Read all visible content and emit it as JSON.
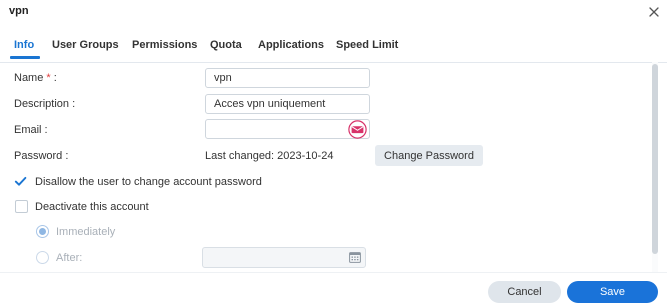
{
  "window": {
    "title": "vpn"
  },
  "tabs": [
    {
      "label": "Info",
      "active": true
    },
    {
      "label": "User Groups"
    },
    {
      "label": "Permissions"
    },
    {
      "label": "Quota"
    },
    {
      "label": "Applications"
    },
    {
      "label": "Speed Limit"
    }
  ],
  "form": {
    "name": {
      "label": "Name",
      "required_mark": "*",
      "colon": ":",
      "value": "vpn"
    },
    "description": {
      "label": "Description :",
      "value": "Acces vpn uniquement"
    },
    "email": {
      "label": "Email :",
      "value": "",
      "icon": "mail-icon"
    },
    "password": {
      "label": "Password :",
      "last_changed": "Last changed: 2023-10-24",
      "button": "Change Password"
    },
    "disallow_change": {
      "label": "Disallow the user to change account password",
      "checked": true
    },
    "deactivate": {
      "label": "Deactivate this account",
      "checked": false
    },
    "immediately": {
      "label": "Immediately",
      "selected": true,
      "disabled": true
    },
    "after": {
      "label": "After:",
      "selected": false,
      "disabled": true,
      "value": "",
      "icon": "calendar-icon"
    }
  },
  "footer": {
    "cancel_label": "Cancel",
    "save_label": "Save"
  },
  "colors": {
    "accent": "#1a75d2",
    "save_button": "#1a73d9",
    "required": "#e03b3b",
    "mail_icon": "#d8336a"
  }
}
